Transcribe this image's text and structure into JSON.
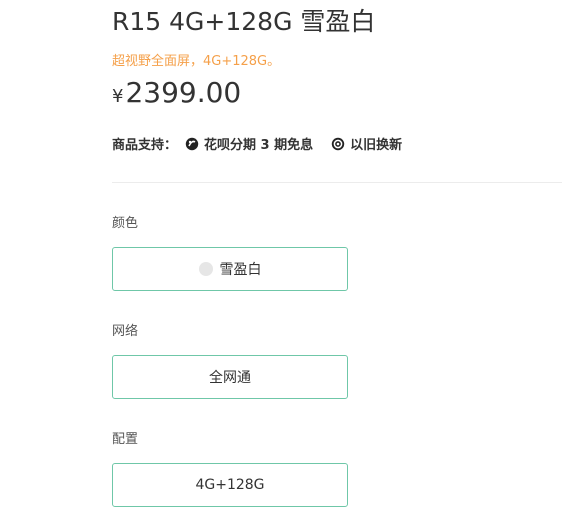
{
  "product": {
    "title": "R15 4G+128G 雪盈白",
    "subtitle": "超视野全面屏，4G+128G。",
    "price_currency": "¥",
    "price_amount": "2399.00"
  },
  "services": {
    "label": "商品支持：",
    "items": [
      {
        "icon": "huabei-icon",
        "text": "花呗分期 3 期免息"
      },
      {
        "icon": "trade-in-icon",
        "text": "以旧换新"
      }
    ]
  },
  "options": {
    "color": {
      "label": "颜色",
      "selected": "雪盈白",
      "swatch": "#e6e6e6"
    },
    "network": {
      "label": "网络",
      "selected": "全网通"
    },
    "config": {
      "label": "配置",
      "selected": "4G+128G"
    }
  },
  "colors": {
    "accent": "#f5a04a",
    "selected_border": "#6fc7a8",
    "text": "#333333"
  }
}
